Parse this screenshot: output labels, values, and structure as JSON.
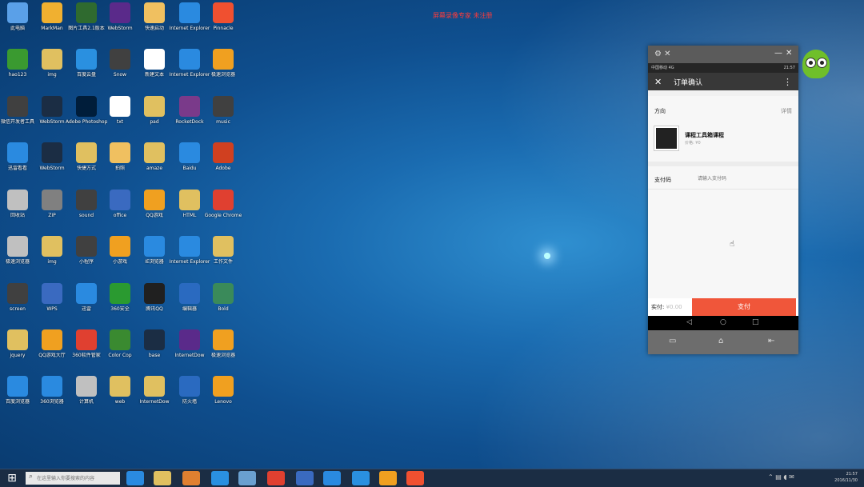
{
  "top_note": "屏幕录像专家 未注册",
  "desktop_icons": [
    {
      "label": "此电脑",
      "color": "#5aa0e8"
    },
    {
      "label": "MarkMan",
      "color": "#f0b030"
    },
    {
      "label": "图片工具2.1版本",
      "color": "#2f6a2f"
    },
    {
      "label": "WebStorm",
      "color": "#5a2a8a"
    },
    {
      "label": "快速启动",
      "color": "#f0c060"
    },
    {
      "label": "Internet Explorer",
      "color": "#2a8ae0"
    },
    {
      "label": "Pinnacle",
      "color": "#f05030"
    },
    {
      "label": "hao123",
      "color": "#3a9a30"
    },
    {
      "label": "img",
      "color": "#e0c060"
    },
    {
      "label": "百度云盘",
      "color": "#2a90e0"
    },
    {
      "label": "Snow",
      "color": "#404040"
    },
    {
      "label": "新建文本",
      "color": "#ffffff"
    },
    {
      "label": "Internet Explorer",
      "color": "#2a8ae0"
    },
    {
      "label": "极速浏览器",
      "color": "#f0a020"
    },
    {
      "label": "微信开发者工具",
      "color": "#404040"
    },
    {
      "label": "WebStorm",
      "color": "#1b2d44"
    },
    {
      "label": "Adobe Photoshop",
      "color": "#001d3a"
    },
    {
      "label": "txt",
      "color": "#ffffff"
    },
    {
      "label": "pad",
      "color": "#e0c060"
    },
    {
      "label": "RocketDock",
      "color": "#7a3a8a"
    },
    {
      "label": "music",
      "color": "#404040"
    },
    {
      "label": "迅雷看看",
      "color": "#2a8ae0"
    },
    {
      "label": "WebStorm",
      "color": "#1b2d44"
    },
    {
      "label": "快捷方式",
      "color": "#e0c060"
    },
    {
      "label": "拍照",
      "color": "#f0c060"
    },
    {
      "label": "amaze",
      "color": "#e0c060"
    },
    {
      "label": "Baidu",
      "color": "#2a8ae0"
    },
    {
      "label": "Adobe",
      "color": "#d04020"
    },
    {
      "label": "回收站",
      "color": "#c0c0c0"
    },
    {
      "label": "ZIP",
      "color": "#808080"
    },
    {
      "label": "sound",
      "color": "#404040"
    },
    {
      "label": "office",
      "color": "#3a6ac0"
    },
    {
      "label": "QQ游戏",
      "color": "#f0a020"
    },
    {
      "label": "HTML",
      "color": "#e0c060"
    },
    {
      "label": "Google Chrome",
      "color": "#e04030"
    },
    {
      "label": "极速浏览器",
      "color": "#c0c0c0"
    },
    {
      "label": "img",
      "color": "#e0c060"
    },
    {
      "label": "小程序",
      "color": "#404040"
    },
    {
      "label": "小游戏",
      "color": "#f0a020"
    },
    {
      "label": "IE浏览器",
      "color": "#2a8ae0"
    },
    {
      "label": "Internet Explorer",
      "color": "#2a8ae0"
    },
    {
      "label": "工作文件",
      "color": "#e0c060"
    },
    {
      "label": "screen",
      "color": "#404040"
    },
    {
      "label": "WPS",
      "color": "#3a6ac0"
    },
    {
      "label": "迅雷",
      "color": "#2a8ae0"
    },
    {
      "label": "360安全",
      "color": "#2a9a30"
    },
    {
      "label": "腾讯QQ",
      "color": "#202020"
    },
    {
      "label": "编辑器",
      "color": "#2a6ac0"
    },
    {
      "label": "Bold",
      "color": "#3a8a5a"
    },
    {
      "label": "jquery",
      "color": "#e0c060"
    },
    {
      "label": "QQ游戏大厅",
      "color": "#f0a020"
    },
    {
      "label": "360软件管家",
      "color": "#e04030"
    },
    {
      "label": "Color Cop",
      "color": "#3a8a30"
    },
    {
      "label": "base",
      "color": "#1b2d44"
    },
    {
      "label": "InternetDow",
      "color": "#5a2a8a"
    },
    {
      "label": "极速浏览器",
      "color": "#f0a020"
    },
    {
      "label": "百度浏览器",
      "color": "#2a8ae0"
    },
    {
      "label": "360浏览器",
      "color": "#2a8ae0"
    },
    {
      "label": "计算机",
      "color": "#c0c0c0"
    },
    {
      "label": "web",
      "color": "#e0c060"
    },
    {
      "label": "InternetDow",
      "color": "#e0c060"
    },
    {
      "label": "防火墙",
      "color": "#2a6ac0"
    },
    {
      "label": "Lenovo",
      "color": "#f0a020"
    }
  ],
  "phone": {
    "status_left": "中国移动 4G",
    "status_right": "21:57",
    "app_title": "订单确认",
    "section_label": "方向",
    "section_more": "详情",
    "product_name": "课程工具箱课程",
    "product_sub": "价格: ¥0",
    "pay_label": "支付码",
    "pay_placeholder": "请输入支付码",
    "total_label": "实付:",
    "total_amount": "¥0.00",
    "pay_button": "支付"
  },
  "taskbar": {
    "search_placeholder": "在这里输入你要搜索的内容",
    "time": "21:57",
    "date": "2016/11/30"
  }
}
